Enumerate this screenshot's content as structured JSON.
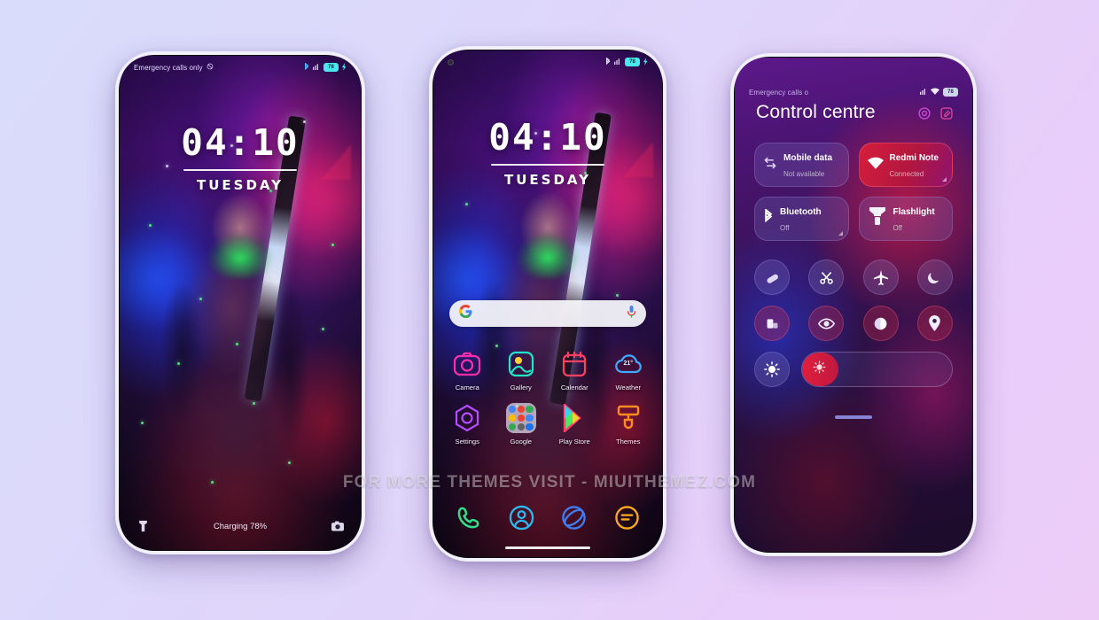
{
  "theme": {
    "page_background_start": "#d9dcfb",
    "page_background_end": "#edcdf8",
    "accent_red": "#d61e3c",
    "accent_purple": "#5a1a86"
  },
  "watermark": {
    "text": "FOR MORE THEMES VISIT - MIUITHEMEZ.COM"
  },
  "lockscreen": {
    "statusbar": {
      "carrier": "Emergency calls only",
      "mute_icon": "mute-icon",
      "bluetooth_icon": "bluetooth-icon",
      "signal_icon": "signal-icon",
      "battery_text": "78",
      "charging_icon": "charging-bolt-icon"
    },
    "clock": {
      "time": "04:10",
      "day": "TUESDAY"
    },
    "bottom": {
      "flashlight_icon": "flashlight-icon",
      "status_text": "Charging 78%",
      "camera_icon": "camera-icon"
    }
  },
  "homescreen": {
    "statusbar": {
      "notch_icon": "camera-notch-icon",
      "bluetooth_icon": "bluetooth-icon",
      "signal_icon": "signal-icon",
      "battery_text": "78",
      "charging_icon": "charging-bolt-icon"
    },
    "search": {
      "google_icon": "google-g-icon",
      "mic_icon": "microphone-icon",
      "placeholder": ""
    },
    "apps": [
      [
        {
          "label": "Camera",
          "icon": "camera-icon",
          "color": "#ff2ea8"
        },
        {
          "label": "Gallery",
          "icon": "gallery-icon",
          "color": "#22e6c8"
        },
        {
          "label": "Calendar",
          "icon": "calendar-icon",
          "color": "#ff4060"
        },
        {
          "label": "Weather",
          "icon": "weather-icon",
          "color": "#3fa9ff",
          "badge": "21°"
        }
      ],
      [
        {
          "label": "Settings",
          "icon": "settings-icon",
          "color": "#b44cff"
        },
        {
          "label": "Google",
          "icon": "google-folder-icon",
          "color": "#e2deee"
        },
        {
          "label": "Play Store",
          "icon": "play-store-icon",
          "color": "#49e86a"
        },
        {
          "label": "Themes",
          "icon": "themes-icon",
          "color": "#ff8a1e"
        }
      ]
    ],
    "dock": [
      {
        "label": "Phone",
        "icon": "phone-icon",
        "color": "#2fe08a"
      },
      {
        "label": "Contacts",
        "icon": "contacts-icon",
        "color": "#2ab8f0"
      },
      {
        "label": "Browser",
        "icon": "browser-icon",
        "color": "#3f7cf0"
      },
      {
        "label": "Messages",
        "icon": "messages-icon",
        "color": "#ffa91e"
      }
    ]
  },
  "controlcentre": {
    "statusbar": {
      "carrier": "Emergency calls o",
      "signal_icon": "signal-icon",
      "wifi_icon": "wifi-icon",
      "battery_text": "78"
    },
    "title": "Control centre",
    "actions": [
      {
        "name": "settings-icon",
        "label": "Settings"
      },
      {
        "name": "edit-icon",
        "label": "Edit"
      }
    ],
    "tiles": [
      [
        {
          "title": "Mobile data",
          "subtitle": "Not available",
          "icon": "mobile-data-icon",
          "state": "off"
        },
        {
          "title": "Redmi Note",
          "subtitle": "Connected",
          "icon": "wifi-icon",
          "state": "on"
        }
      ],
      [
        {
          "title": "Bluetooth",
          "subtitle": "Off",
          "icon": "bluetooth-icon",
          "state": "off"
        },
        {
          "title": "Flashlight",
          "subtitle": "Off",
          "icon": "flashlight-bulb-icon",
          "state": "off"
        }
      ]
    ],
    "toggles": [
      [
        {
          "name": "eraser-icon",
          "label": "Clear",
          "state": "off"
        },
        {
          "name": "scissors-icon",
          "label": "Screenshot",
          "state": "off"
        },
        {
          "name": "airplane-icon",
          "label": "Airplane mode",
          "state": "off"
        },
        {
          "name": "moon-icon",
          "label": "Dark mode",
          "state": "off"
        }
      ],
      [
        {
          "name": "cast-icon",
          "label": "Cast",
          "state": "on"
        },
        {
          "name": "eye-icon",
          "label": "Reading mode",
          "state": "on"
        },
        {
          "name": "contrast-icon",
          "label": "Contrast",
          "state": "on"
        },
        {
          "name": "location-icon",
          "label": "Location",
          "state": "on"
        }
      ]
    ],
    "brightness": {
      "auto_icon": "auto-brightness-icon",
      "slider_icon": "brightness-icon",
      "level_percent": 24
    }
  }
}
